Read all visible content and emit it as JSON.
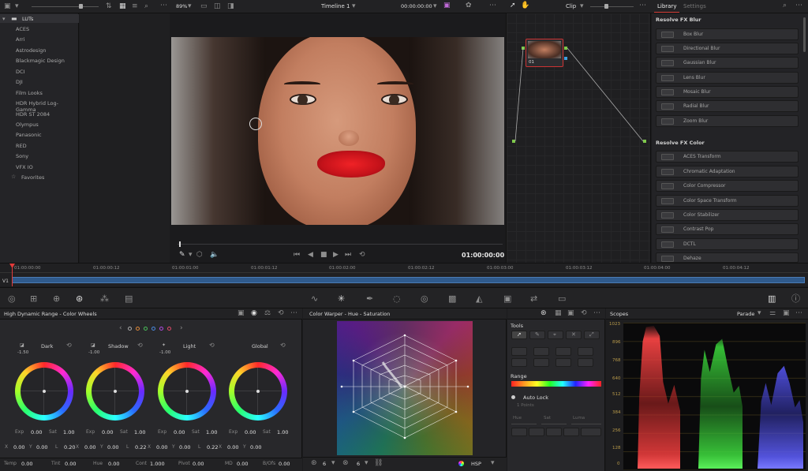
{
  "top_toolbar": {
    "zoom": "89%",
    "timeline_name": "Timeline 1",
    "timecode": "00:00:00:00",
    "clip_label": "Clip"
  },
  "right_tabs": {
    "library": "Library",
    "settings": "Settings"
  },
  "luts": {
    "root": "LUTs",
    "items": [
      "ACES",
      "Arri",
      "Astrodesign",
      "Blackmagic Design",
      "DCI",
      "DJI",
      "Film Looks",
      "HDR Hybrid Log-Gamma",
      "HDR ST 2084",
      "Olympus",
      "Panasonic",
      "RED",
      "Sony",
      "VFX IO"
    ],
    "favorites": "Favorites"
  },
  "library": {
    "blur_header": "Resolve FX Blur",
    "blur_items": [
      "Box Blur",
      "Directional Blur",
      "Gaussian Blur",
      "Lens Blur",
      "Mosaic Blur",
      "Radial Blur",
      "Zoom Blur"
    ],
    "color_header": "Resolve FX Color",
    "color_items": [
      "ACES Transform",
      "Chromatic Adaptation",
      "Color Compressor",
      "Color Space Transform",
      "Color Stabilizer",
      "Contrast Pop",
      "DCTL",
      "Dehaze"
    ]
  },
  "node": {
    "label": "01"
  },
  "viewer": {
    "timecode": "01:00:00:00"
  },
  "timeline": {
    "track": "V1",
    "ticks": [
      "01:00:00:00",
      "01:00:00:12",
      "01:00:01:00",
      "01:00:01:12",
      "01:00:02:00",
      "01:00:02:12",
      "01:00:03:00",
      "01:00:03:12",
      "01:00:04:00",
      "01:00:04:12"
    ]
  },
  "wheels_panel": {
    "title": "High Dynamic Range - Color Wheels",
    "wheels": [
      {
        "name": "Dark",
        "value": "-1.50",
        "exp": "0.00",
        "sat": "1.00",
        "x": "0.00",
        "y": "0.00",
        "l": "0.20"
      },
      {
        "name": "Shadow",
        "value": "-1.00",
        "exp": "0.00",
        "sat": "1.00",
        "x": "0.00",
        "y": "0.00",
        "l": "0.22"
      },
      {
        "name": "Light",
        "value": "-1.00",
        "exp": "0.00",
        "sat": "1.00",
        "x": "0.00",
        "y": "0.00",
        "l": "0.22"
      },
      {
        "name": "Global",
        "value": "",
        "exp": "0.00",
        "sat": "1.00",
        "x": "0.00",
        "y": "0.00",
        "l": ""
      }
    ],
    "labels": {
      "exp": "Exp",
      "sat": "Sat",
      "x": "X",
      "y": "Y",
      "l": "L"
    }
  },
  "bottom_params": {
    "temp_label": "Temp",
    "temp": "0.00",
    "tint_label": "Tint",
    "tint": "0.00",
    "hue_label": "Hue",
    "hue": "0.00",
    "cont_label": "Cont",
    "cont": "1.000",
    "pivot_label": "Pivot",
    "pivot": "0.00",
    "md_label": "MD",
    "md": "0.00",
    "bofs_label": "B/Ofs",
    "bofs": "0.00"
  },
  "warper": {
    "title": "Color Warper - Hue - Saturation",
    "grid1": "6",
    "grid2": "6",
    "mode": "HSP"
  },
  "tools": {
    "title": "Tools",
    "range": "Range",
    "autolock": "Auto Lock",
    "points": "1 Points",
    "hue": "Hue",
    "sat": "Sat",
    "luma": "Luma"
  },
  "scopes": {
    "title": "Scopes",
    "mode": "Parade",
    "scale": [
      "1023",
      "896",
      "768",
      "640",
      "512",
      "384",
      "256",
      "128",
      "0"
    ]
  }
}
